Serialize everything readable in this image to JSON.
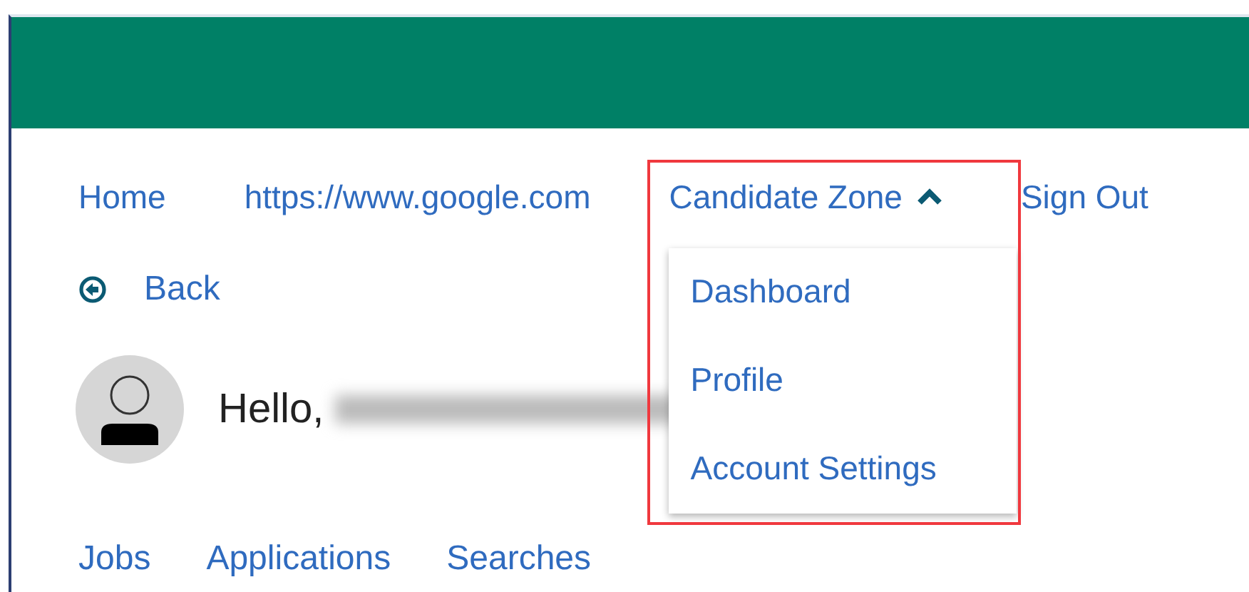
{
  "nav": [
    {
      "label": "Home",
      "kind": "link"
    },
    {
      "label": "https://www.google.com",
      "kind": "link"
    },
    {
      "label": "Candidate Zone",
      "kind": "dropdown",
      "expanded": true,
      "menu": [
        "Dashboard",
        "Profile",
        "Account Settings"
      ]
    },
    {
      "label": "Sign Out",
      "kind": "link"
    }
  ],
  "back": {
    "label": "Back"
  },
  "greeting": {
    "text": "Hello,",
    "name_redacted": true
  },
  "tabs": [
    {
      "label": "Jobs"
    },
    {
      "label": "Applications"
    },
    {
      "label": "Searches"
    }
  ],
  "highlight": true
}
